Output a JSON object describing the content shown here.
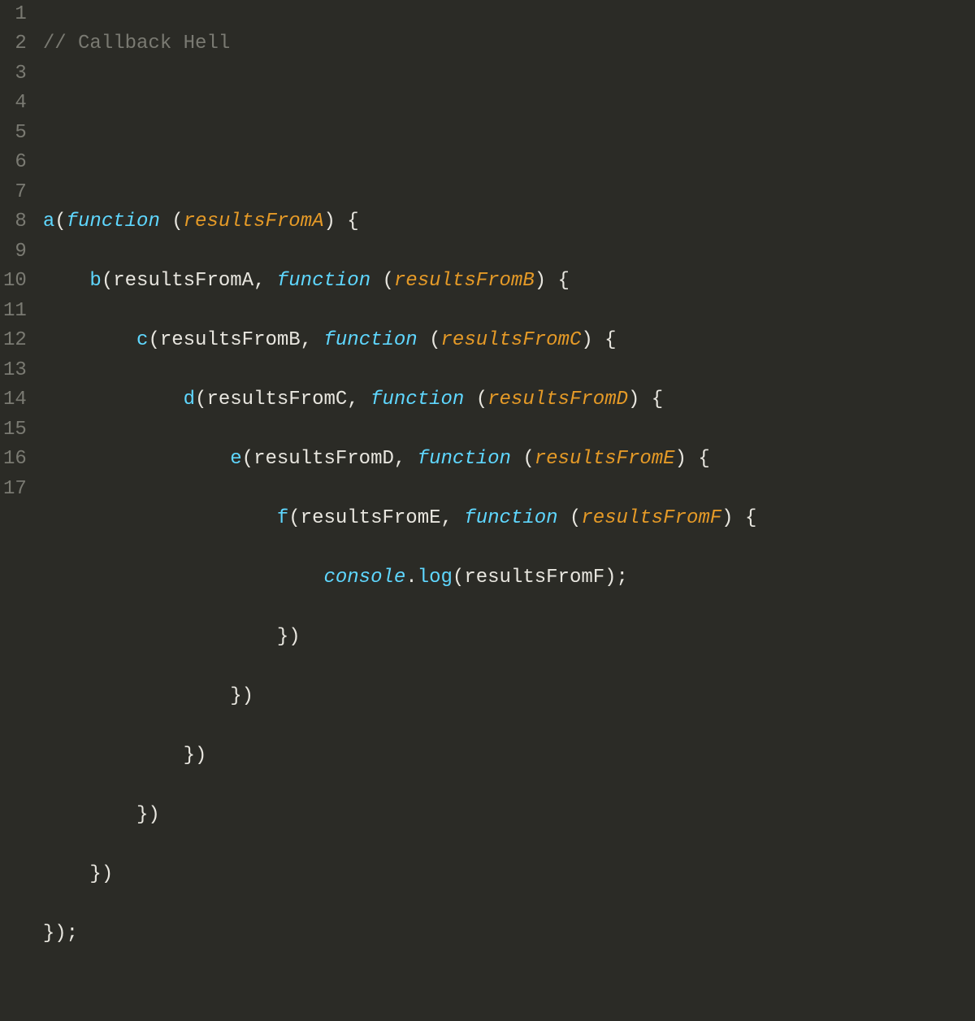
{
  "colors": {
    "background": "#2b2b26",
    "gutter_text": "#7a7a72",
    "default_text": "#e8e6df",
    "comment": "#7a7a72",
    "function_name": "#5fd7ff",
    "keyword": "#5fd7ff",
    "parameter": "#e59a27"
  },
  "line_numbers": [
    "1",
    "2",
    "3",
    "4",
    "5",
    "6",
    "7",
    "8",
    "9",
    "10",
    "11",
    "12",
    "13",
    "14",
    "15",
    "16",
    "17"
  ],
  "code": {
    "comment_line": "// Callback Hell",
    "l4": {
      "fn": "a",
      "kw": "function",
      "param": "resultsFromA"
    },
    "l5": {
      "fn": "b",
      "arg": "resultsFromA",
      "kw": "function",
      "param": "resultsFromB"
    },
    "l6": {
      "fn": "c",
      "arg": "resultsFromB",
      "kw": "function",
      "param": "resultsFromC"
    },
    "l7": {
      "fn": "d",
      "arg": "resultsFromC",
      "kw": "function",
      "param": "resultsFromD"
    },
    "l8": {
      "fn": "e",
      "arg": "resultsFromD",
      "kw": "function",
      "param": "resultsFromE"
    },
    "l9": {
      "fn": "f",
      "arg": "resultsFromE",
      "kw": "function",
      "param": "resultsFromF"
    },
    "l10": {
      "obj": "console",
      "method": "log",
      "arg": "resultsFromF"
    },
    "l11": {
      "close": "})"
    },
    "l12": {
      "close": "})"
    },
    "l13": {
      "close": "})"
    },
    "l14": {
      "close": "})"
    },
    "l15": {
      "close": "})"
    },
    "l16": {
      "close": "});"
    }
  }
}
